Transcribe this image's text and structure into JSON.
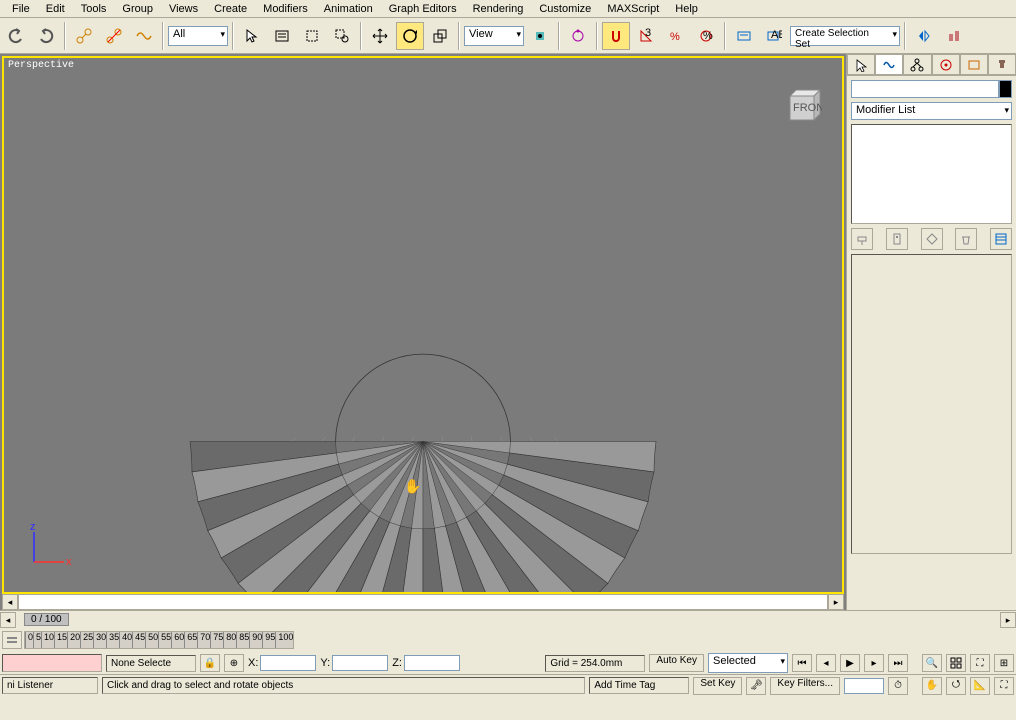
{
  "menu": {
    "items": [
      "File",
      "Edit",
      "Tools",
      "Group",
      "Views",
      "Create",
      "Modifiers",
      "Animation",
      "Graph Editors",
      "Rendering",
      "Customize",
      "MAXScript",
      "Help"
    ]
  },
  "toolbar": {
    "filter_dropdown": "All",
    "ref_dropdown": "View",
    "selection_set": "Create Selection Set"
  },
  "viewport": {
    "label": "Perspective",
    "viewcube_face": "FRONT",
    "axes": {
      "up": "z",
      "right": "x"
    }
  },
  "right_panel": {
    "name_value": "",
    "modifier_list": "Modifier List"
  },
  "timeline": {
    "frame_indicator": "0 / 100",
    "ticks": [
      "0",
      "5",
      "10",
      "15",
      "20",
      "25",
      "30",
      "35",
      "40",
      "45",
      "50",
      "55",
      "60",
      "65",
      "70",
      "75",
      "80",
      "85",
      "90",
      "95",
      "100"
    ]
  },
  "status": {
    "selection": "None Selecte",
    "x_label": "X:",
    "y_label": "Y:",
    "z_label": "Z:",
    "x_val": "",
    "y_val": "",
    "z_val": "",
    "grid": "Grid = 254.0mm",
    "autokey": "Auto Key",
    "setkey": "Set Key",
    "keymode_dropdown": "Selected",
    "keyfilters": "Key Filters...",
    "listener_label": "ni Listener",
    "prompt": "Click and drag to select and rotate objects",
    "timetag": "Add Time Tag"
  }
}
